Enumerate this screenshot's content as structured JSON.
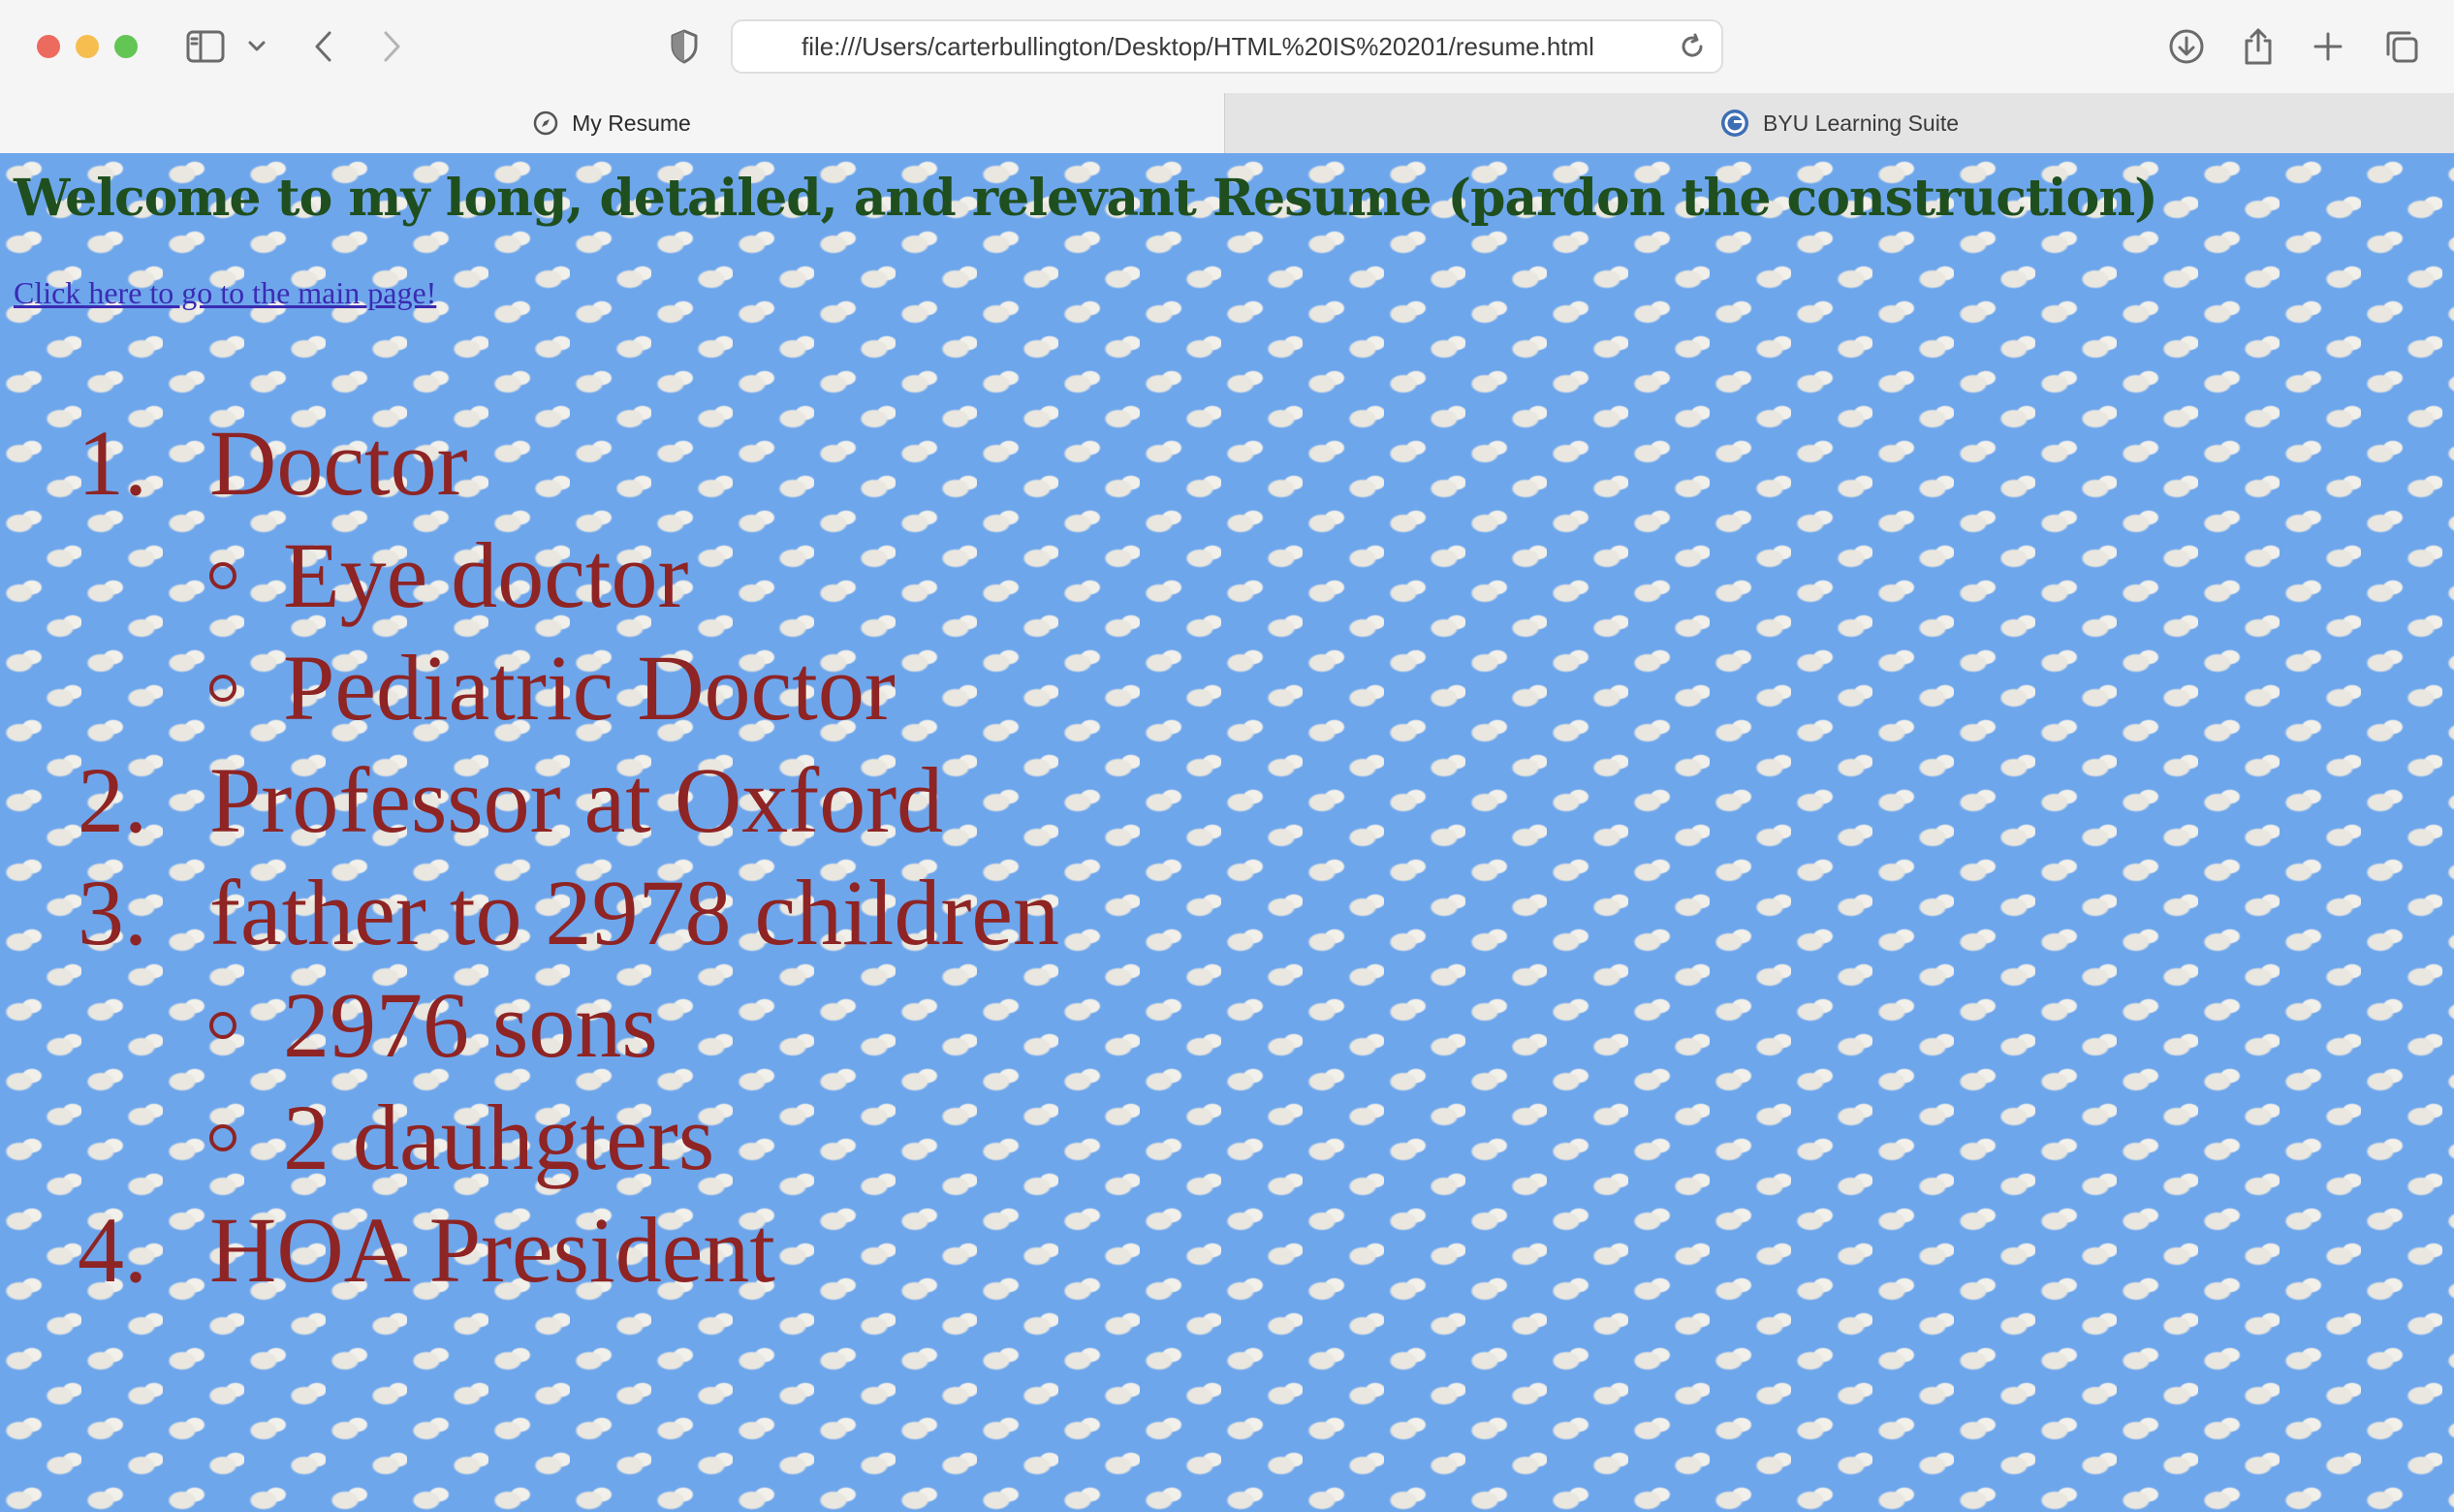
{
  "browser": {
    "url": "file:///Users/carterbullington/Desktop/HTML%20IS%20201/resume.html",
    "tabs": [
      {
        "label": "My Resume",
        "icon": "compass-icon",
        "active": true
      },
      {
        "label": "BYU Learning Suite",
        "icon": "learning-suite-icon",
        "active": false
      }
    ]
  },
  "page": {
    "title": "Welcome to my long, detailed, and relevant Resume (pardon the construction)",
    "link_text": "Click here to go to the main page!",
    "list": [
      {
        "number": "1.",
        "text": "Doctor"
      },
      {
        "bullet": "○",
        "text": "Eye doctor"
      },
      {
        "bullet": "○",
        "text": "Pediatric Doctor"
      },
      {
        "number": "2.",
        "text": "Professor at Oxford"
      },
      {
        "number": "3.",
        "text": "father to 2978 children"
      },
      {
        "bullet": "○",
        "text": "2976 sons"
      },
      {
        "bullet": "○",
        "text": "2 dauhgters"
      },
      {
        "number": "4.",
        "text": "HOA President"
      }
    ]
  },
  "colors": {
    "title": "#1f4f1f",
    "list_text": "#8e2424",
    "link": "#3b2bb3",
    "sky_background": "#6ea6ec"
  }
}
